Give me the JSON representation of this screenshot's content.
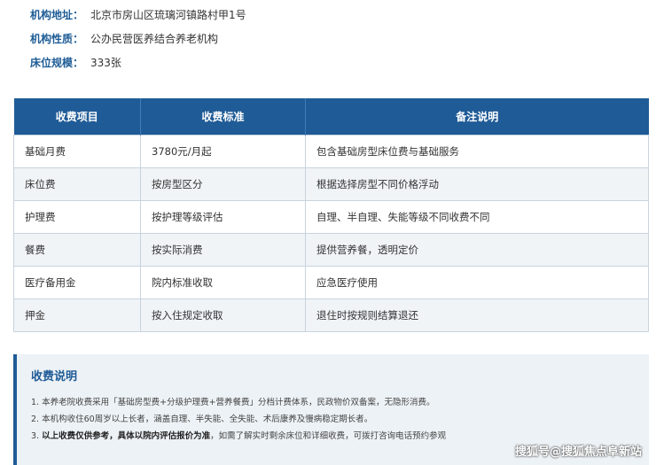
{
  "info": [
    {
      "label": "机构地址：",
      "value": "北京市房山区琉璃河镇路村甲1号"
    },
    {
      "label": "机构性质：",
      "value": "公办民营医养结合养老机构"
    },
    {
      "label": "床位规模：",
      "value": "333张"
    }
  ],
  "table": {
    "headers": [
      "收费项目",
      "收费标准",
      "备注说明"
    ],
    "rows": [
      [
        "基础月费",
        "3780元/月起",
        "包含基础房型床位费与基础服务"
      ],
      [
        "床位费",
        "按房型区分",
        "根据选择房型不同价格浮动"
      ],
      [
        "护理费",
        "按护理等级评估",
        "自理、半自理、失能等级不同收费不同"
      ],
      [
        "餐费",
        "按实际消费",
        "提供营养餐，透明定价"
      ],
      [
        "医疗备用金",
        "院内标准收取",
        "应急医疗使用"
      ],
      [
        "押金",
        "按入住规定收取",
        "退住时按规则结算退还"
      ]
    ]
  },
  "notes": {
    "title": "收费说明",
    "items": [
      {
        "num": "1.",
        "bold": "",
        "text": "本养老院收费采用「基础房型费+分级护理费+营养餐费」分档计费体系，民政物价双备案，无隐形消费。"
      },
      {
        "num": "2.",
        "bold": "",
        "text": "本机构收住60周岁以上长者，涵盖自理、半失能、全失能、术后康养及慢病稳定期长者。"
      },
      {
        "num": "3.",
        "bold": "以上收费仅供参考，具体以院内评估报价为准",
        "text": "，如需了解实时剩余床位和详细收费，可拨打咨询电话预约参观"
      }
    ]
  },
  "watermark": "搜狐号@搜狐焦点阜新站"
}
